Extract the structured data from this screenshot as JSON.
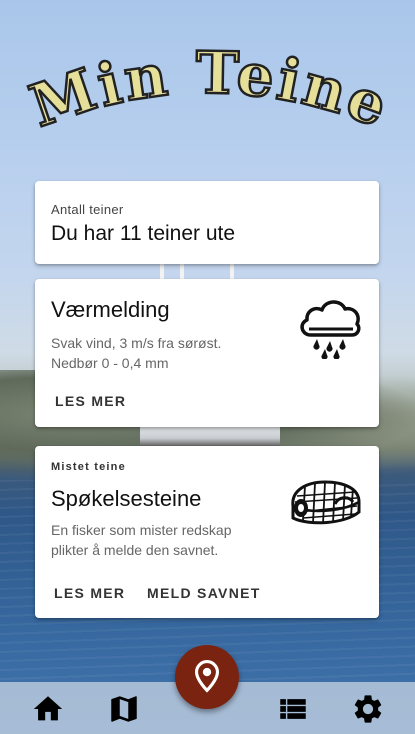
{
  "app": {
    "title": "Min Teine"
  },
  "count_card": {
    "overline": "Antall teiner",
    "headline": "Du har 11 teiner ute"
  },
  "weather_card": {
    "headline": "Værmelding",
    "line1": "Svak vind, 3 m/s fra sørøst.",
    "line2": "Nedbør 0 - 0,4 mm",
    "more_label": "LES MER",
    "icon": "rain-cloud-icon"
  },
  "ghost_card": {
    "overline": "Mistet teine",
    "headline": "Spøkelsesteine",
    "line1": "En fisker som mister redskap",
    "line2": "plikter å melde den savnet.",
    "more_label": "LES MER",
    "report_label": "MELD SAVNET",
    "icon": "crab-pot-icon"
  },
  "bottom_nav": {
    "items": [
      {
        "icon": "home-icon"
      },
      {
        "icon": "map-icon"
      },
      {
        "icon": "location-pin-icon"
      },
      {
        "icon": "list-icon"
      },
      {
        "icon": "gear-icon"
      }
    ]
  },
  "colors": {
    "title_fill": "#e6df9a",
    "title_stroke": "#222222",
    "fab": "#7a2310",
    "card": "#ffffff"
  }
}
